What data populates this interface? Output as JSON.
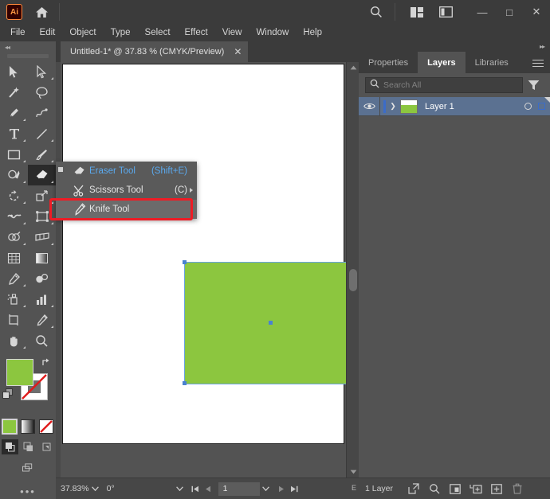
{
  "app": {
    "name": "Adobe Illustrator",
    "logo_text": "Ai",
    "logo_color": "#ff9a44"
  },
  "titlebar": {
    "home_icon": "home-icon",
    "search_icon": "search-icon",
    "arrange_icon": "arrange-documents-icon",
    "workspace_icon": "workspace-switcher-icon",
    "minimize": "—",
    "maximize": "□",
    "close": "✕"
  },
  "menubar": {
    "items": [
      {
        "label": "File"
      },
      {
        "label": "Edit"
      },
      {
        "label": "Object"
      },
      {
        "label": "Type"
      },
      {
        "label": "Select"
      },
      {
        "label": "Effect"
      },
      {
        "label": "View"
      },
      {
        "label": "Window"
      },
      {
        "label": "Help"
      }
    ]
  },
  "toolbar": {
    "collapse_icon": "double-chevron-left-icon",
    "tools": [
      {
        "name": "selection-tool",
        "icon": "arrow-solid-icon",
        "corner": false,
        "active": false
      },
      {
        "name": "direct-selection-tool",
        "icon": "arrow-outline-icon",
        "corner": true,
        "active": false
      },
      {
        "name": "magic-wand-tool",
        "icon": "magic-wand-icon",
        "corner": false,
        "active": false
      },
      {
        "name": "lasso-tool",
        "icon": "lasso-icon",
        "corner": false,
        "active": false
      },
      {
        "name": "pen-tool",
        "icon": "pen-icon",
        "corner": true,
        "active": false
      },
      {
        "name": "curvature-tool",
        "icon": "curvature-icon",
        "corner": false,
        "active": false
      },
      {
        "name": "type-tool",
        "icon": "type-icon",
        "corner": true,
        "active": false
      },
      {
        "name": "line-segment-tool",
        "icon": "line-icon",
        "corner": true,
        "active": false
      },
      {
        "name": "rectangle-tool",
        "icon": "rectangle-icon",
        "corner": true,
        "active": false
      },
      {
        "name": "paintbrush-tool",
        "icon": "paintbrush-icon",
        "corner": true,
        "active": false
      },
      {
        "name": "shaper-tool",
        "icon": "shaper-pencil-icon",
        "corner": true,
        "active": false
      },
      {
        "name": "eraser-tool",
        "icon": "eraser-icon",
        "corner": true,
        "active": true
      },
      {
        "name": "rotate-tool",
        "icon": "rotate-icon",
        "corner": true,
        "active": false
      },
      {
        "name": "scale-tool",
        "icon": "scale-icon",
        "corner": true,
        "active": false
      },
      {
        "name": "width-tool",
        "icon": "width-icon",
        "corner": true,
        "active": false
      },
      {
        "name": "free-transform-tool",
        "icon": "free-transform-icon",
        "corner": true,
        "active": false
      },
      {
        "name": "shape-builder-tool",
        "icon": "shape-builder-icon",
        "corner": true,
        "active": false
      },
      {
        "name": "perspective-grid-tool",
        "icon": "perspective-grid-icon",
        "corner": true,
        "active": false
      },
      {
        "name": "mesh-tool",
        "icon": "mesh-icon",
        "corner": false,
        "active": false
      },
      {
        "name": "gradient-tool",
        "icon": "gradient-icon",
        "corner": false,
        "active": false
      },
      {
        "name": "eyedropper-tool",
        "icon": "eyedropper-icon",
        "corner": true,
        "active": false
      },
      {
        "name": "blend-tool",
        "icon": "blend-icon",
        "corner": false,
        "active": false
      },
      {
        "name": "symbol-sprayer-tool",
        "icon": "symbol-sprayer-icon",
        "corner": true,
        "active": false
      },
      {
        "name": "column-graph-tool",
        "icon": "column-graph-icon",
        "corner": true,
        "active": false
      },
      {
        "name": "artboard-tool",
        "icon": "artboard-icon",
        "corner": false,
        "active": false
      },
      {
        "name": "slice-tool",
        "icon": "slice-knife-icon",
        "corner": true,
        "active": false
      },
      {
        "name": "hand-tool",
        "icon": "hand-icon",
        "corner": true,
        "active": false
      },
      {
        "name": "zoom-tool",
        "icon": "magnifier-icon",
        "corner": false,
        "active": false
      }
    ],
    "fill_color": "#8cc63f",
    "stroke_color": "#ffffff",
    "swap_icon": "swap-fill-stroke-icon",
    "default_icon": "default-fill-stroke-icon",
    "color_modes": [
      {
        "name": "color-mode-color",
        "selected": true
      },
      {
        "name": "color-mode-gradient",
        "selected": false
      },
      {
        "name": "color-mode-none",
        "selected": false
      }
    ],
    "drawing_modes": [
      {
        "name": "draw-normal-mode",
        "selected": true
      },
      {
        "name": "draw-behind-mode",
        "selected": false
      },
      {
        "name": "draw-inside-mode",
        "selected": false
      }
    ],
    "screen_mode_icon": "screen-mode-icon",
    "edit_toolbar_icon": "edit-toolbar-dots-icon",
    "edit_toolbar_glyph": "•••"
  },
  "document": {
    "tab_title": "Untitled-1* @ 37.83 % (CMYK/Preview)",
    "close_glyph": "✕",
    "artwork": {
      "shape": "green-rectangle",
      "fill": "#8cc63f",
      "selection_color": "#4a82d0"
    },
    "scroll": {
      "up_glyph": "▲",
      "down_glyph": "▼"
    }
  },
  "flyout_menu": {
    "name": "eraser-tool-flyout",
    "items": [
      {
        "name": "flyout-eraser-tool",
        "label": "Eraser Tool",
        "shortcut": "(Shift+E)",
        "icon": "eraser-icon",
        "highlighted": true,
        "selected": false,
        "submenu": false
      },
      {
        "name": "flyout-scissors-tool",
        "label": "Scissors Tool",
        "shortcut": "(C)",
        "icon": "scissors-icon",
        "highlighted": false,
        "selected": false,
        "submenu": true
      },
      {
        "name": "flyout-knife-tool",
        "label": "Knife Tool",
        "shortcut": "",
        "icon": "knife-icon",
        "highlighted": false,
        "selected": true,
        "submenu": false
      }
    ],
    "annotation_color": "#ee1c25"
  },
  "statusbar": {
    "zoom_value": "37.83%",
    "rotate_value": "0°",
    "page_value": "1",
    "caret_glyph": "⌄",
    "first_glyph": "⏮",
    "prev_glyph": "◀",
    "next_glyph": "▶",
    "last_glyph": "⏭",
    "edge_letter": "E"
  },
  "right_panel": {
    "collapse_icon": "double-chevron-right-icon",
    "tabs": [
      {
        "name": "tab-properties",
        "label": "Properties",
        "active": false
      },
      {
        "name": "tab-layers",
        "label": "Layers",
        "active": true
      },
      {
        "name": "tab-libraries",
        "label": "Libraries",
        "active": false
      }
    ],
    "panel_menu_icon": "hamburger-menu-icon",
    "search": {
      "placeholder": "Search All",
      "icon": "search-icon",
      "filter_icon": "filter-funnel-icon"
    },
    "layers": [
      {
        "name": "layer-row-layer-1",
        "label": "Layer 1",
        "visible": true,
        "selected": true,
        "eye_icon": "eye-icon",
        "expand_glyph": "❯",
        "thumb_color": "#8cc63f"
      }
    ],
    "footer": {
      "count_label": "1 Layer",
      "icons": [
        {
          "name": "release-to-layers-icon"
        },
        {
          "name": "locate-object-icon"
        },
        {
          "name": "make-clipping-mask-icon"
        },
        {
          "name": "create-new-sublayer-icon"
        },
        {
          "name": "create-new-layer-icon"
        },
        {
          "name": "delete-selection-icon"
        }
      ]
    }
  }
}
